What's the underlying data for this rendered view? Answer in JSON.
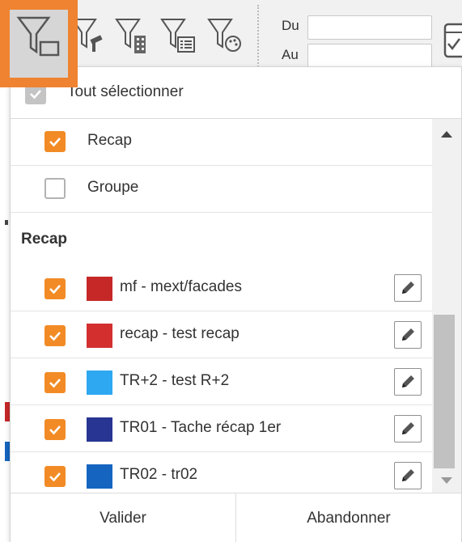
{
  "toolbar": {
    "tools": [
      {
        "icon": "filter-display-icon",
        "active": true
      },
      {
        "icon": "filter-paint-icon",
        "active": false
      },
      {
        "icon": "filter-building-icon",
        "active": false
      },
      {
        "icon": "filter-list-icon",
        "active": false
      },
      {
        "icon": "filter-palette-icon",
        "active": false
      }
    ],
    "date_from_label": "Du",
    "date_to_label": "Au",
    "date_from_value": "",
    "date_to_value": "",
    "active_border_color": "#ef8331"
  },
  "dropdown": {
    "select_all_label": "Tout sélectionner",
    "groups": [
      {
        "label": "Recap",
        "checked": true
      },
      {
        "label": "Groupe",
        "checked": false
      }
    ],
    "section_title": "Recap",
    "items": [
      {
        "label": "mf - mext/facades",
        "color": "#c62828",
        "checked": true
      },
      {
        "label": "recap - test recap",
        "color": "#d32f2f",
        "checked": true
      },
      {
        "label": "TR+2 - test R+2",
        "color": "#2ea8f0",
        "checked": true
      },
      {
        "label": "TR01 - Tache récap 1er",
        "color": "#283593",
        "checked": true
      },
      {
        "label": "TR02 - tr02",
        "color": "#1565c0",
        "checked": true
      }
    ],
    "validate_label": "Valider",
    "cancel_label": "Abandonner",
    "checkbox_color": "#f28b25"
  }
}
